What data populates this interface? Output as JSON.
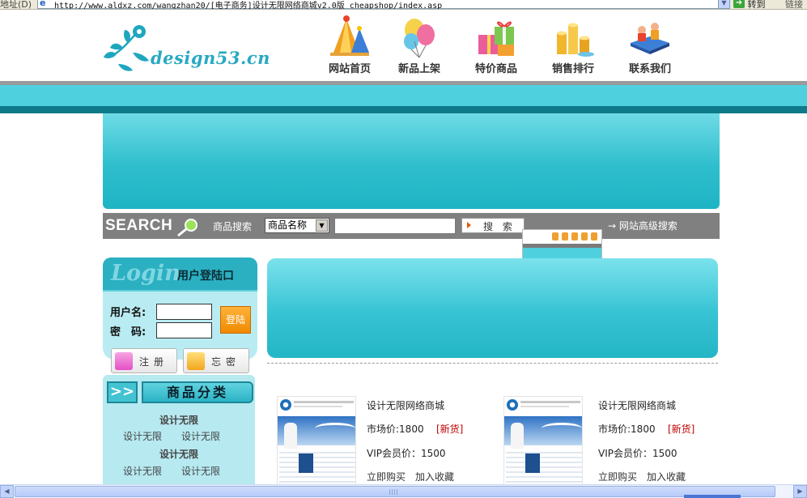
{
  "browser": {
    "address_label": "地址(D)",
    "url": "http://www.aldxz.com/wangzhan20/[电子商务]设计无限网络商城v2.0版_cheapshop/index.asp",
    "go_label": "转到",
    "links_label": "链接"
  },
  "header": {
    "logo_text": "design53.cn",
    "nav": [
      {
        "label": "网站首页",
        "icon": "party-hat-icon"
      },
      {
        "label": "新品上架",
        "icon": "balloon-icon"
      },
      {
        "label": "特价商品",
        "icon": "gift-box-icon"
      },
      {
        "label": "销售排行",
        "icon": "coins-icon"
      },
      {
        "label": "联系我们",
        "icon": "book-people-icon"
      }
    ]
  },
  "search": {
    "title": "SEARCH",
    "label": "商品搜索",
    "select_value": "商品名称",
    "input_value": "",
    "button_label": "搜 索",
    "advanced_link": "→ 网站高级搜索"
  },
  "login": {
    "word": "Login",
    "title": "用户登陆口",
    "username_label": "用户名:",
    "password_label": "密　码:",
    "submit_label": "登陆",
    "register_label": "注册",
    "forgot_label": "忘密"
  },
  "category": {
    "arrow": ">>",
    "title": "商品分类",
    "groups": [
      {
        "title": "设计无限",
        "items": [
          "设计无限",
          "设计无限"
        ]
      },
      {
        "title": "设计无限",
        "items": [
          "设计无限",
          "设计无限"
        ]
      }
    ]
  },
  "products": [
    {
      "name": "设计无限网络商城",
      "price": "市场价:1800",
      "badge": "[新货]",
      "vip": "VIP会员价：1500",
      "buy": "立即购买",
      "favorite": "加入收藏"
    },
    {
      "name": "设计无限网络商城",
      "price": "市场价:1800",
      "badge": "[新货]",
      "vip": "VIP会员价：1500",
      "buy": "立即购买",
      "favorite": "加入收藏"
    }
  ],
  "colors": {
    "accent_cyan": "#4fd0de",
    "dark_teal": "#0f7a8a",
    "search_bar": "#808080",
    "badge_red": "#c00000"
  }
}
